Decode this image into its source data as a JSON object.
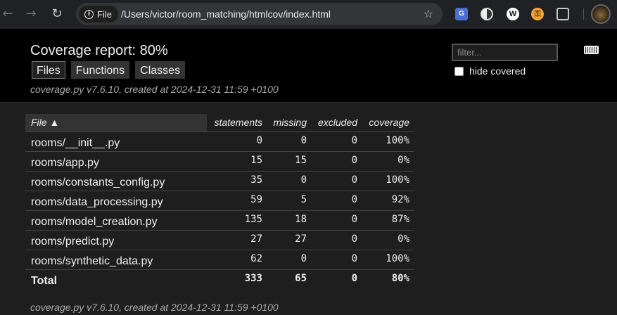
{
  "browser": {
    "chip_label": "File",
    "url": "/Users/victor/room_matching/htmlcov/index.html",
    "translate_ext": "G"
  },
  "header": {
    "title": "Coverage report: 80%",
    "tabs": [
      {
        "label": "Files",
        "active": true
      },
      {
        "label": "Functions",
        "active": false
      },
      {
        "label": "Classes",
        "active": false
      }
    ],
    "created": "coverage.py v7.6.10, created at 2024-12-31 11:59 +0100",
    "filter_placeholder": "filter...",
    "hide_covered_label": "hide covered"
  },
  "table": {
    "columns": {
      "file": "File ▲",
      "statements": "statements",
      "missing": "missing",
      "excluded": "excluded",
      "coverage": "coverage"
    },
    "rows": [
      {
        "file": "rooms/__init__.py",
        "statements": "0",
        "missing": "0",
        "excluded": "0",
        "coverage": "100%"
      },
      {
        "file": "rooms/app.py",
        "statements": "15",
        "missing": "15",
        "excluded": "0",
        "coverage": "0%"
      },
      {
        "file": "rooms/constants_config.py",
        "statements": "35",
        "missing": "0",
        "excluded": "0",
        "coverage": "100%"
      },
      {
        "file": "rooms/data_processing.py",
        "statements": "59",
        "missing": "5",
        "excluded": "0",
        "coverage": "92%"
      },
      {
        "file": "rooms/model_creation.py",
        "statements": "135",
        "missing": "18",
        "excluded": "0",
        "coverage": "87%"
      },
      {
        "file": "rooms/predict.py",
        "statements": "27",
        "missing": "27",
        "excluded": "0",
        "coverage": "0%"
      },
      {
        "file": "rooms/synthetic_data.py",
        "statements": "62",
        "missing": "0",
        "excluded": "0",
        "coverage": "100%"
      }
    ],
    "total": {
      "file": "Total",
      "statements": "333",
      "missing": "65",
      "excluded": "0",
      "coverage": "80%"
    }
  },
  "footer": {
    "created": "coverage.py v7.6.10, created at 2024-12-31 11:59 +0100"
  }
}
